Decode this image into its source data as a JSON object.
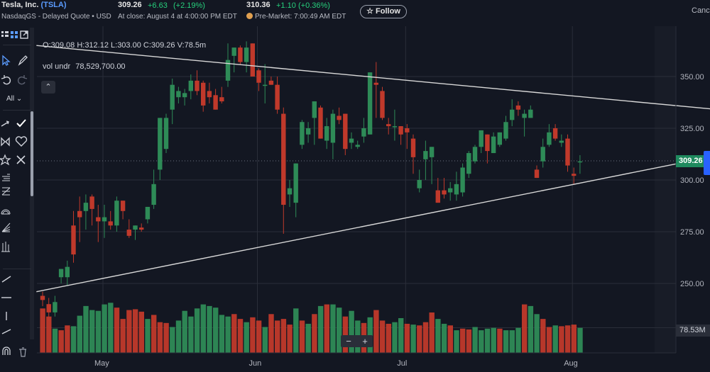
{
  "header": {
    "company": "Tesla, Inc.",
    "ticker": "(TSLA)",
    "exchange": "NasdaqGS - Delayed Quote • USD",
    "price": "309.26",
    "change": "+6.63",
    "change_pct": "(+2.19%)",
    "close_note": "At close: August 4 at 4:00:00 PM EDT",
    "pre_price": "310.36",
    "pre_change": "+1.10",
    "pre_change_pct": "(+0.36%)",
    "pre_note": "Pre-Market: 7:00:49 AM EDT",
    "follow_label": "Follow",
    "cancel_label": "Canc"
  },
  "toolbar": {
    "interval_label": "All",
    "interval_chevron": "⌄"
  },
  "legend": {
    "ohlc": "O:309.08  H:312.12  L:303.00  C:309.26  V:78.5m",
    "vol_label": "vol undr",
    "vol_value": "78,529,700.00",
    "collapse_glyph": "⌃"
  },
  "zoom": {
    "minus": "−",
    "plus": "+"
  },
  "price_tag": "309.26",
  "vol_tag": "78.53M",
  "colors": {
    "up": "#2e8b57",
    "down": "#c0392b",
    "background": "#131722",
    "grid": "#2a2e39",
    "trendline": "#d8d8d8",
    "price_tag": "#1f8a5e"
  },
  "chart_data": {
    "type": "candlestick",
    "y_ticks": [
      "350.00",
      "325.00",
      "300.00",
      "275.00",
      "250.00"
    ],
    "x_ticks": [
      "May",
      "Jun",
      "Jul",
      "Aug"
    ],
    "ylim": [
      220,
      370
    ],
    "grid": true,
    "candles": [
      {
        "o": 244,
        "h": 246,
        "l": 239,
        "c": 242
      },
      {
        "o": 240,
        "h": 243,
        "l": 232,
        "c": 236
      },
      {
        "o": 236,
        "h": 244,
        "l": 234,
        "c": 241
      },
      {
        "o": 253,
        "h": 255,
        "l": 250,
        "c": 257
      },
      {
        "o": 253,
        "h": 261,
        "l": 249,
        "c": 258
      },
      {
        "o": 278,
        "h": 285,
        "l": 260,
        "c": 264
      },
      {
        "o": 285,
        "h": 292,
        "l": 270,
        "c": 282
      },
      {
        "o": 285,
        "h": 293,
        "l": 276,
        "c": 289
      },
      {
        "o": 292,
        "h": 293,
        "l": 278,
        "c": 286
      },
      {
        "o": 282,
        "h": 288,
        "l": 270,
        "c": 280
      },
      {
        "o": 280,
        "h": 288,
        "l": 272,
        "c": 282
      },
      {
        "o": 280,
        "h": 285,
        "l": 276,
        "c": 278
      },
      {
        "o": 278,
        "h": 292,
        "l": 275,
        "c": 290
      },
      {
        "o": 290,
        "h": 290,
        "l": 281,
        "c": 285
      },
      {
        "o": 276,
        "h": 281,
        "l": 272,
        "c": 273
      },
      {
        "o": 276,
        "h": 277,
        "l": 271,
        "c": 278
      },
      {
        "o": 277,
        "h": 279,
        "l": 275,
        "c": 276
      },
      {
        "o": 281,
        "h": 286,
        "l": 279,
        "c": 287
      },
      {
        "o": 288,
        "h": 305,
        "l": 286,
        "c": 298
      },
      {
        "o": 305,
        "h": 323,
        "l": 300,
        "c": 330
      },
      {
        "o": 315,
        "h": 332,
        "l": 313,
        "c": 330
      },
      {
        "o": 334,
        "h": 349,
        "l": 327,
        "c": 346
      },
      {
        "o": 340,
        "h": 345,
        "l": 337,
        "c": 343
      },
      {
        "o": 340,
        "h": 344,
        "l": 336,
        "c": 342
      },
      {
        "o": 343,
        "h": 351,
        "l": 339,
        "c": 348
      },
      {
        "o": 348,
        "h": 353,
        "l": 341,
        "c": 343
      },
      {
        "o": 347,
        "h": 348,
        "l": 333,
        "c": 336
      },
      {
        "o": 343,
        "h": 347,
        "l": 337,
        "c": 340
      },
      {
        "o": 341,
        "h": 344,
        "l": 335,
        "c": 334
      },
      {
        "o": 340,
        "h": 345,
        "l": 337,
        "c": 338
      },
      {
        "o": 348,
        "h": 366,
        "l": 345,
        "c": 358
      },
      {
        "o": 360,
        "h": 364,
        "l": 352,
        "c": 364
      },
      {
        "o": 364,
        "h": 365,
        "l": 356,
        "c": 357
      },
      {
        "o": 357,
        "h": 367,
        "l": 352,
        "c": 364
      },
      {
        "o": 366,
        "h": 365,
        "l": 350,
        "c": 350
      },
      {
        "o": 353,
        "h": 354,
        "l": 343,
        "c": 347
      },
      {
        "o": 346,
        "h": 356,
        "l": 337,
        "c": 346
      },
      {
        "o": 348,
        "h": 350,
        "l": 346,
        "c": 346
      },
      {
        "o": 346,
        "h": 350,
        "l": 332,
        "c": 334
      },
      {
        "o": 332,
        "h": 335,
        "l": 274,
        "c": 288
      },
      {
        "o": 293,
        "h": 300,
        "l": 287,
        "c": 296
      },
      {
        "o": 289,
        "h": 306,
        "l": 282,
        "c": 308
      },
      {
        "o": 317,
        "h": 329,
        "l": 315,
        "c": 328
      },
      {
        "o": 322,
        "h": 328,
        "l": 318,
        "c": 325
      },
      {
        "o": 330,
        "h": 338,
        "l": 317,
        "c": 338
      },
      {
        "o": 335,
        "h": 336,
        "l": 320,
        "c": 320
      },
      {
        "o": 319,
        "h": 330,
        "l": 315,
        "c": 326
      },
      {
        "o": 318,
        "h": 334,
        "l": 310,
        "c": 332
      },
      {
        "o": 331,
        "h": 335,
        "l": 327,
        "c": 329
      },
      {
        "o": 332,
        "h": 327,
        "l": 312,
        "c": 315
      },
      {
        "o": 318,
        "h": 323,
        "l": 315,
        "c": 320
      },
      {
        "o": 316,
        "h": 319,
        "l": 315,
        "c": 317
      },
      {
        "o": 321,
        "h": 330,
        "l": 318,
        "c": 325
      },
      {
        "o": 322,
        "h": 340,
        "l": 322,
        "c": 352
      },
      {
        "o": 347,
        "h": 357,
        "l": 330,
        "c": 346
      },
      {
        "o": 343,
        "h": 345,
        "l": 329,
        "c": 330
      },
      {
        "o": 327,
        "h": 330,
        "l": 322,
        "c": 326
      },
      {
        "o": 326,
        "h": 334,
        "l": 319,
        "c": 326
      },
      {
        "o": 326,
        "h": 325,
        "l": 317,
        "c": 322
      },
      {
        "o": 325,
        "h": 327,
        "l": 315,
        "c": 323
      },
      {
        "o": 320,
        "h": 322,
        "l": 303,
        "c": 311
      },
      {
        "o": 296,
        "h": 305,
        "l": 294,
        "c": 300
      },
      {
        "o": 310,
        "h": 319,
        "l": 300,
        "c": 314
      },
      {
        "o": 311,
        "h": 316,
        "l": 298,
        "c": 316
      },
      {
        "o": 295,
        "h": 301,
        "l": 290,
        "c": 289
      },
      {
        "o": 295,
        "h": 301,
        "l": 291,
        "c": 293
      },
      {
        "o": 294,
        "h": 299,
        "l": 290,
        "c": 296
      },
      {
        "o": 293,
        "h": 304,
        "l": 290,
        "c": 298
      },
      {
        "o": 294,
        "h": 308,
        "l": 292,
        "c": 306
      },
      {
        "o": 303,
        "h": 314,
        "l": 301,
        "c": 313
      },
      {
        "o": 309,
        "h": 317,
        "l": 308,
        "c": 316
      },
      {
        "o": 316,
        "h": 323,
        "l": 313,
        "c": 324
      },
      {
        "o": 322,
        "h": 319,
        "l": 308,
        "c": 314
      },
      {
        "o": 313,
        "h": 323,
        "l": 313,
        "c": 321
      },
      {
        "o": 317,
        "h": 323,
        "l": 316,
        "c": 323
      },
      {
        "o": 320,
        "h": 331,
        "l": 319,
        "c": 328
      },
      {
        "o": 329,
        "h": 339,
        "l": 326,
        "c": 334
      },
      {
        "o": 336,
        "h": 338,
        "l": 331,
        "c": 334
      },
      {
        "o": 330,
        "h": 334,
        "l": 321,
        "c": 332
      },
      {
        "o": 330,
        "h": 336,
        "l": 330,
        "c": 334
      },
      {
        "o": 305,
        "h": 307,
        "l": 302,
        "c": 301
      },
      {
        "o": 309,
        "h": 320,
        "l": 306,
        "c": 316
      },
      {
        "o": 317,
        "h": 327,
        "l": 316,
        "c": 323
      },
      {
        "o": 325,
        "h": 327,
        "l": 319,
        "c": 320
      },
      {
        "o": 318,
        "h": 322,
        "l": 316,
        "c": 319
      },
      {
        "o": 320,
        "h": 322,
        "l": 304,
        "c": 307
      },
      {
        "o": 303,
        "h": 306,
        "l": 298,
        "c": 302
      },
      {
        "o": 309,
        "h": 312,
        "l": 303,
        "c": 309
      }
    ],
    "volume": [
      {
        "v": 55,
        "up": false
      },
      {
        "v": 45,
        "up": false
      },
      {
        "v": 30,
        "up": true
      },
      {
        "v": 28,
        "up": false
      },
      {
        "v": 34,
        "up": false
      },
      {
        "v": 33,
        "up": true
      },
      {
        "v": 46,
        "up": true
      },
      {
        "v": 58,
        "up": true
      },
      {
        "v": 53,
        "up": true
      },
      {
        "v": 52,
        "up": true
      },
      {
        "v": 60,
        "up": true
      },
      {
        "v": 62,
        "up": true
      },
      {
        "v": 56,
        "up": false
      },
      {
        "v": 42,
        "up": false
      },
      {
        "v": 53,
        "up": false
      },
      {
        "v": 54,
        "up": false
      },
      {
        "v": 51,
        "up": false
      },
      {
        "v": 42,
        "up": true
      },
      {
        "v": 47,
        "up": false
      },
      {
        "v": 38,
        "up": false
      },
      {
        "v": 37,
        "up": false
      },
      {
        "v": 32,
        "up": true
      },
      {
        "v": 40,
        "up": true
      },
      {
        "v": 52,
        "up": true
      },
      {
        "v": 45,
        "up": true
      },
      {
        "v": 55,
        "up": true
      },
      {
        "v": 60,
        "up": true
      },
      {
        "v": 58,
        "up": true
      },
      {
        "v": 56,
        "up": true
      },
      {
        "v": 47,
        "up": true
      },
      {
        "v": 45,
        "up": true
      },
      {
        "v": 48,
        "up": false
      },
      {
        "v": 42,
        "up": false
      },
      {
        "v": 38,
        "up": true
      },
      {
        "v": 44,
        "up": false
      },
      {
        "v": 40,
        "up": false
      },
      {
        "v": 32,
        "up": true
      },
      {
        "v": 48,
        "up": false
      },
      {
        "v": 40,
        "up": false
      },
      {
        "v": 42,
        "up": false
      },
      {
        "v": 35,
        "up": false
      },
      {
        "v": 55,
        "up": true
      },
      {
        "v": 40,
        "up": false
      },
      {
        "v": 36,
        "up": true
      },
      {
        "v": 48,
        "up": false
      },
      {
        "v": 58,
        "up": true
      },
      {
        "v": 60,
        "up": false
      },
      {
        "v": 60,
        "up": true
      },
      {
        "v": 56,
        "up": true
      },
      {
        "v": 45,
        "up": false
      },
      {
        "v": 52,
        "up": true
      },
      {
        "v": 40,
        "up": true
      },
      {
        "v": 37,
        "up": false
      },
      {
        "v": 44,
        "up": true
      },
      {
        "v": 53,
        "up": false
      },
      {
        "v": 40,
        "up": false
      },
      {
        "v": 36,
        "up": false
      },
      {
        "v": 38,
        "up": true
      },
      {
        "v": 43,
        "up": true
      },
      {
        "v": 36,
        "up": false
      },
      {
        "v": 35,
        "up": true
      },
      {
        "v": 34,
        "up": false
      },
      {
        "v": 38,
        "up": false
      },
      {
        "v": 50,
        "up": false
      },
      {
        "v": 42,
        "up": true
      },
      {
        "v": 36,
        "up": true
      },
      {
        "v": 34,
        "up": false
      },
      {
        "v": 28,
        "up": true
      },
      {
        "v": 30,
        "up": false
      },
      {
        "v": 29,
        "up": false
      },
      {
        "v": 32,
        "up": true
      },
      {
        "v": 28,
        "up": true
      },
      {
        "v": 30,
        "up": true
      },
      {
        "v": 31,
        "up": true
      },
      {
        "v": 30,
        "up": false
      },
      {
        "v": 28,
        "up": true
      },
      {
        "v": 28,
        "up": true
      },
      {
        "v": 31,
        "up": true
      },
      {
        "v": 60,
        "up": false
      },
      {
        "v": 58,
        "up": true
      },
      {
        "v": 48,
        "up": true
      },
      {
        "v": 42,
        "up": false
      },
      {
        "v": 32,
        "up": false
      },
      {
        "v": 34,
        "up": true
      },
      {
        "v": 33,
        "up": false
      },
      {
        "v": 34,
        "up": false
      },
      {
        "v": 35,
        "up": false
      },
      {
        "v": 31,
        "up": true
      }
    ],
    "trendlines": [
      {
        "from": {
          "bar": -1,
          "price": 365
        },
        "to": {
          "bar": 113,
          "price": 333
        }
      },
      {
        "from": {
          "bar": -1,
          "price": 246
        },
        "to": {
          "bar": 113,
          "price": 314
        }
      }
    ]
  }
}
